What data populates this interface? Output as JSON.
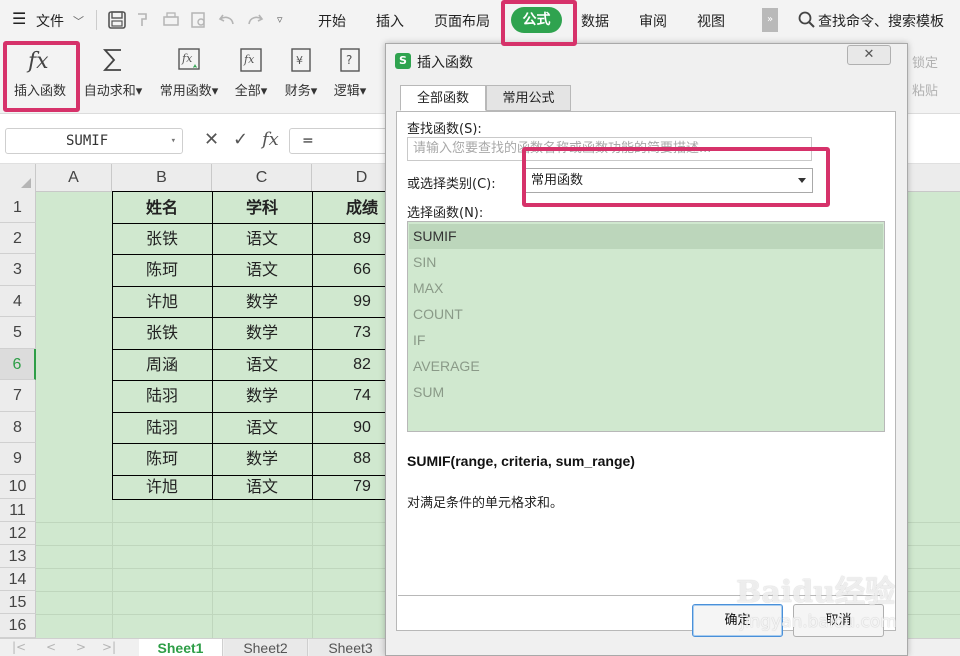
{
  "menubar": {
    "file_label": "文件",
    "tabs": [
      "开始",
      "插入",
      "页面布局",
      "公式",
      "数据",
      "审阅",
      "视图"
    ],
    "active_tab": "公式",
    "more_label": "»",
    "search_label": "查找命令、搜索模板",
    "accent_color": "#2fa34f"
  },
  "ribbon": {
    "buttons": [
      {
        "label": "插入函数",
        "icon": "fx-icon"
      },
      {
        "label": "自动求和▾",
        "icon": "sigma-icon"
      },
      {
        "label": "常用函数▾",
        "icon": "star-fx-icon"
      },
      {
        "label": "全部▾",
        "icon": "fx-box-icon"
      },
      {
        "label": "财务▾",
        "icon": "finance-icon"
      },
      {
        "label": "逻辑▾",
        "icon": "logic-icon"
      }
    ],
    "right_texts": [
      "锁定",
      "粘贴"
    ]
  },
  "formula_bar": {
    "name_box": "SUMIF",
    "cancel_symbol": "✕",
    "confirm_symbol": "✓",
    "fx_symbol": "fx",
    "content": "="
  },
  "sheet": {
    "columns": [
      "A",
      "B",
      "C",
      "D"
    ],
    "rows": [
      "1",
      "2",
      "3",
      "4",
      "5",
      "6",
      "7",
      "8",
      "9",
      "10",
      "11",
      "12",
      "13",
      "14",
      "15",
      "16"
    ],
    "active_row": "6",
    "header": [
      "姓名",
      "学科",
      "成绩"
    ],
    "data": [
      [
        "张铁",
        "语文",
        "89"
      ],
      [
        "陈珂",
        "语文",
        "66"
      ],
      [
        "许旭",
        "数学",
        "99"
      ],
      [
        "张铁",
        "数学",
        "73"
      ],
      [
        "周涵",
        "语文",
        "82"
      ],
      [
        "陆羽",
        "数学",
        "74"
      ],
      [
        "陆羽",
        "语文",
        "90"
      ],
      [
        "陈珂",
        "数学",
        "88"
      ],
      [
        "许旭",
        "语文",
        "79"
      ]
    ],
    "tabs": [
      "Sheet1",
      "Sheet2",
      "Sheet3"
    ],
    "active_tab": "Sheet1",
    "grid_color": "#d0e8cf"
  },
  "dialog": {
    "title": "插入函数",
    "logo_letter": "S",
    "close_symbol": "✕",
    "tabs": [
      "全部函数",
      "常用公式"
    ],
    "search_label": "查找函数(S):",
    "search_placeholder": "请输入您要查找的函数名称或函数功能的简要描述...",
    "category_label": "或选择类别(C):",
    "category_value": "常用函数",
    "list_label": "选择函数(N):",
    "functions": [
      "SUMIF",
      "SIN",
      "MAX",
      "COUNT",
      "IF",
      "AVERAGE",
      "SUM"
    ],
    "selected_function": "SUMIF",
    "syntax": "SUMIF(range, criteria, sum_range)",
    "description": "对满足条件的单元格求和。",
    "ok_label": "确定",
    "cancel_label": "取消"
  },
  "highlight_color": "#d6326a",
  "watermark": {
    "line1": "Baidu经验",
    "line2": "jingyan.baidu.com"
  }
}
